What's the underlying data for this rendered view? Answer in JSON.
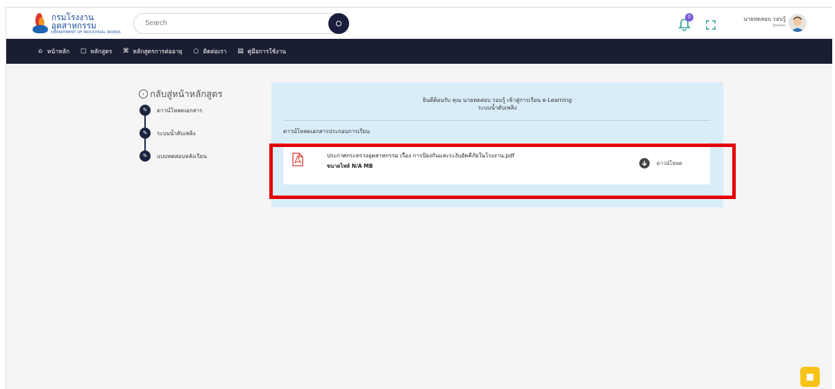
{
  "brand": {
    "name_th": "กรมโรงงานอุตสาหกรรม",
    "name_en": "DEPARTMENT OF INDUSTRIAL WORKS"
  },
  "search": {
    "placeholder": "Search"
  },
  "header": {
    "notification_count": "0",
    "user_name": "นายทดสอบ รอบรู้",
    "user_role": "ผู้ทดสอบ"
  },
  "nav": {
    "items": [
      {
        "label": "หน้าหลัก",
        "icon": "home-icon"
      },
      {
        "label": "หลักสูตร",
        "icon": "book-icon"
      },
      {
        "label": "หลักสูตรการต่ออายุ",
        "icon": "command-icon"
      },
      {
        "label": "ติดต่อเรา",
        "icon": "chat-icon"
      },
      {
        "label": "คู่มือการใช้งาน",
        "icon": "manual-icon"
      }
    ]
  },
  "sidebar": {
    "back_label": "กลับสู่หน้าหลักสูตร",
    "steps": [
      {
        "label": "ดาวน์โหลดเอกสาร"
      },
      {
        "label": "ระบบน้ำดับเพลิง"
      },
      {
        "label": "แบบทดสอบหลังเรียน"
      }
    ]
  },
  "content": {
    "welcome_line1": "ยินดีต้อนรับ คุณ นายทดสอบ รอบรู้ เข้าสู่การเรียน e-Learning",
    "welcome_line2": "ระบบน้ำดับเพลิง",
    "section_title": "ดาวน์โหลดเอกสารประกอบการเรียน",
    "file": {
      "title": "ประกาศกระทรวงอุตสาหกรรม เรื่อง การป้องกันและระงับอัคคีภัยในโรงงาน.pdf",
      "size": "ขนาดไฟล์ N/A MB",
      "download_label": "ดาวน์โหลด"
    }
  },
  "colors": {
    "navbar": "#1a1e33",
    "card_bg": "#d9edf8",
    "highlight": "#e50000",
    "fab": "#f8c317",
    "pdf_red": "#d93025"
  }
}
